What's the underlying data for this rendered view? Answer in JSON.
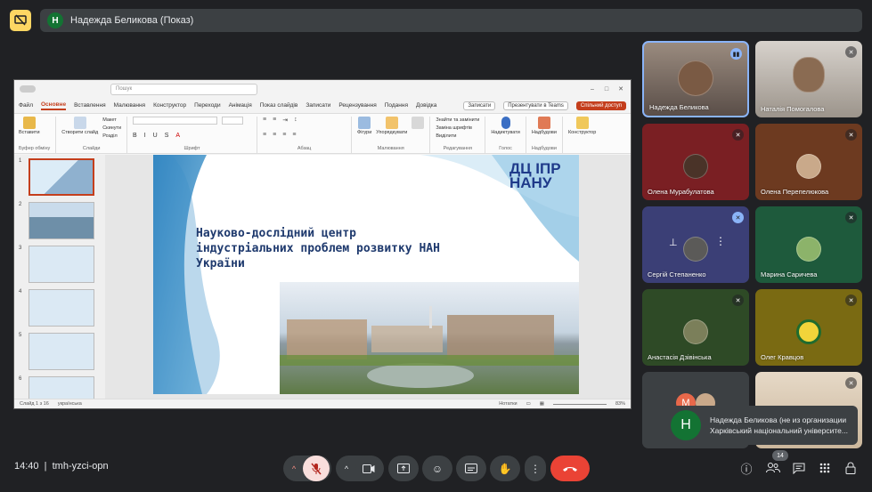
{
  "meeting": {
    "presenter_title": "Надежда Беликова (Показ)",
    "presenter_initial": "Н",
    "time": "14:40",
    "code": "tmh-yzci-opn",
    "participant_count": "14"
  },
  "ppt": {
    "search_placeholder": "Пошук",
    "menu": [
      "Файл",
      "Основне",
      "Вставлення",
      "Малювання",
      "Конструктор",
      "Переходи",
      "Анімація",
      "Показ слайдів",
      "Записати",
      "Рецензування",
      "Подання",
      "Довідка"
    ],
    "active_menu": "Основне",
    "record_label": "Записати",
    "teams_label": "Презентувати в Teams",
    "share_label": "Спільний доступ",
    "ribbon_groups": [
      "Буфер обміну",
      "Слайди",
      "Шрифт",
      "Абзац",
      "Малювання",
      "Редагування",
      "Голос",
      "Надбудови"
    ],
    "ribbon_items": {
      "paste": "Вставити",
      "new_slide": "Створити слайд",
      "layout": "Макет",
      "reset": "Скинути",
      "section": "Розділ",
      "shapes": "Фігури",
      "arrange": "Упорядкувати",
      "find_replace": "Знайти та замінити",
      "replace_fonts": "Заміна шрифтів",
      "select": "Виділити",
      "dictate": "Надиктувати",
      "addins": "Надбудови",
      "designer": "Конструктор"
    },
    "slide_count_label": "Слайд 1 з 16",
    "language": "українська",
    "notes_label": "Нотатки",
    "zoom": "83%",
    "thumb_numbers": [
      "1",
      "2",
      "3",
      "4",
      "5",
      "6"
    ]
  },
  "slide": {
    "title_line1": "Науково-дослідний центр",
    "title_line2": "індустріальних проблем розвитку НАН",
    "title_line3": "України",
    "logo_line1": "ДЦ ІПР",
    "logo_line2": "НАНУ"
  },
  "participants": [
    {
      "name": "Надежда Беликова",
      "mic": "speaking"
    },
    {
      "name": "Наталія Помогалова",
      "mic": "muted"
    },
    {
      "name": "Олена Мурабулатова",
      "mic": "muted"
    },
    {
      "name": "Олена Перепелюкова",
      "mic": "muted"
    },
    {
      "name": "Сергій Степаненко",
      "mic": "muted"
    },
    {
      "name": "Марина Саричева",
      "mic": "muted"
    },
    {
      "name": "Анастасія Дзівінська",
      "mic": "muted"
    },
    {
      "name": "Олег Кравцов",
      "mic": "muted"
    },
    {
      "name": "",
      "mic": "none"
    },
    {
      "name": "",
      "mic": "muted"
    }
  ],
  "toast": {
    "initial": "Н",
    "text": "Надежда Беликова (не из организации Харківський національний університе..."
  },
  "colors": {
    "background": "#202124",
    "hangup": "#ea4335",
    "present_icon": "#fdd663",
    "ppt_accent": "#c43e1c"
  }
}
